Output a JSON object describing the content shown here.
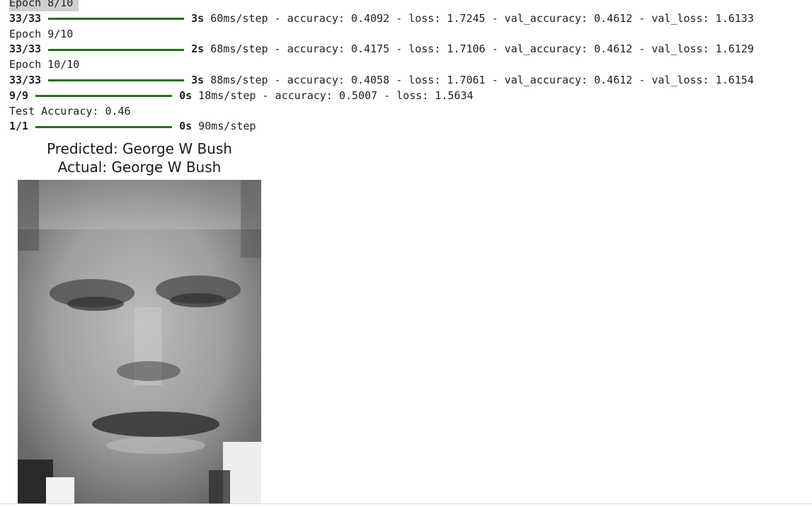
{
  "console": {
    "lines": [
      {
        "type": "epoch",
        "text": "Epoch 8/10",
        "selected": true
      },
      {
        "type": "progress",
        "step": "33/33",
        "bar": "w192",
        "time": "3s",
        "rest": " 60ms/step - accuracy: 0.4092 - loss: 1.7245 - val_accuracy: 0.4612 - val_loss: 1.6133"
      },
      {
        "type": "epoch",
        "text": "Epoch 9/10"
      },
      {
        "type": "progress",
        "step": "33/33",
        "bar": "w192",
        "time": "2s",
        "rest": " 68ms/step - accuracy: 0.4175 - loss: 1.7106 - val_accuracy: 0.4612 - val_loss: 1.6129"
      },
      {
        "type": "epoch",
        "text": "Epoch 10/10"
      },
      {
        "type": "progress",
        "step": "33/33",
        "bar": "w192",
        "time": "3s",
        "rest": " 88ms/step - accuracy: 0.4058 - loss: 1.7061 - val_accuracy: 0.4612 - val_loss: 1.6154"
      },
      {
        "type": "progress",
        "step": "9/9",
        "bar": "w193",
        "time": "0s",
        "rest": " 18ms/step - accuracy: 0.5007 - loss: 1.5634"
      },
      {
        "type": "text",
        "text": "Test Accuracy: 0.46"
      },
      {
        "type": "progress",
        "step": "1/1",
        "bar": "w193",
        "time": "0s",
        "rest": " 90ms/step"
      }
    ]
  },
  "figure": {
    "predicted": "Predicted: George W Bush",
    "actual": "Actual: George W Bush",
    "image": "grayscale-face-image"
  },
  "colors": {
    "progress_bar": "#2a6e1e",
    "selection": "#cfcfcf"
  }
}
